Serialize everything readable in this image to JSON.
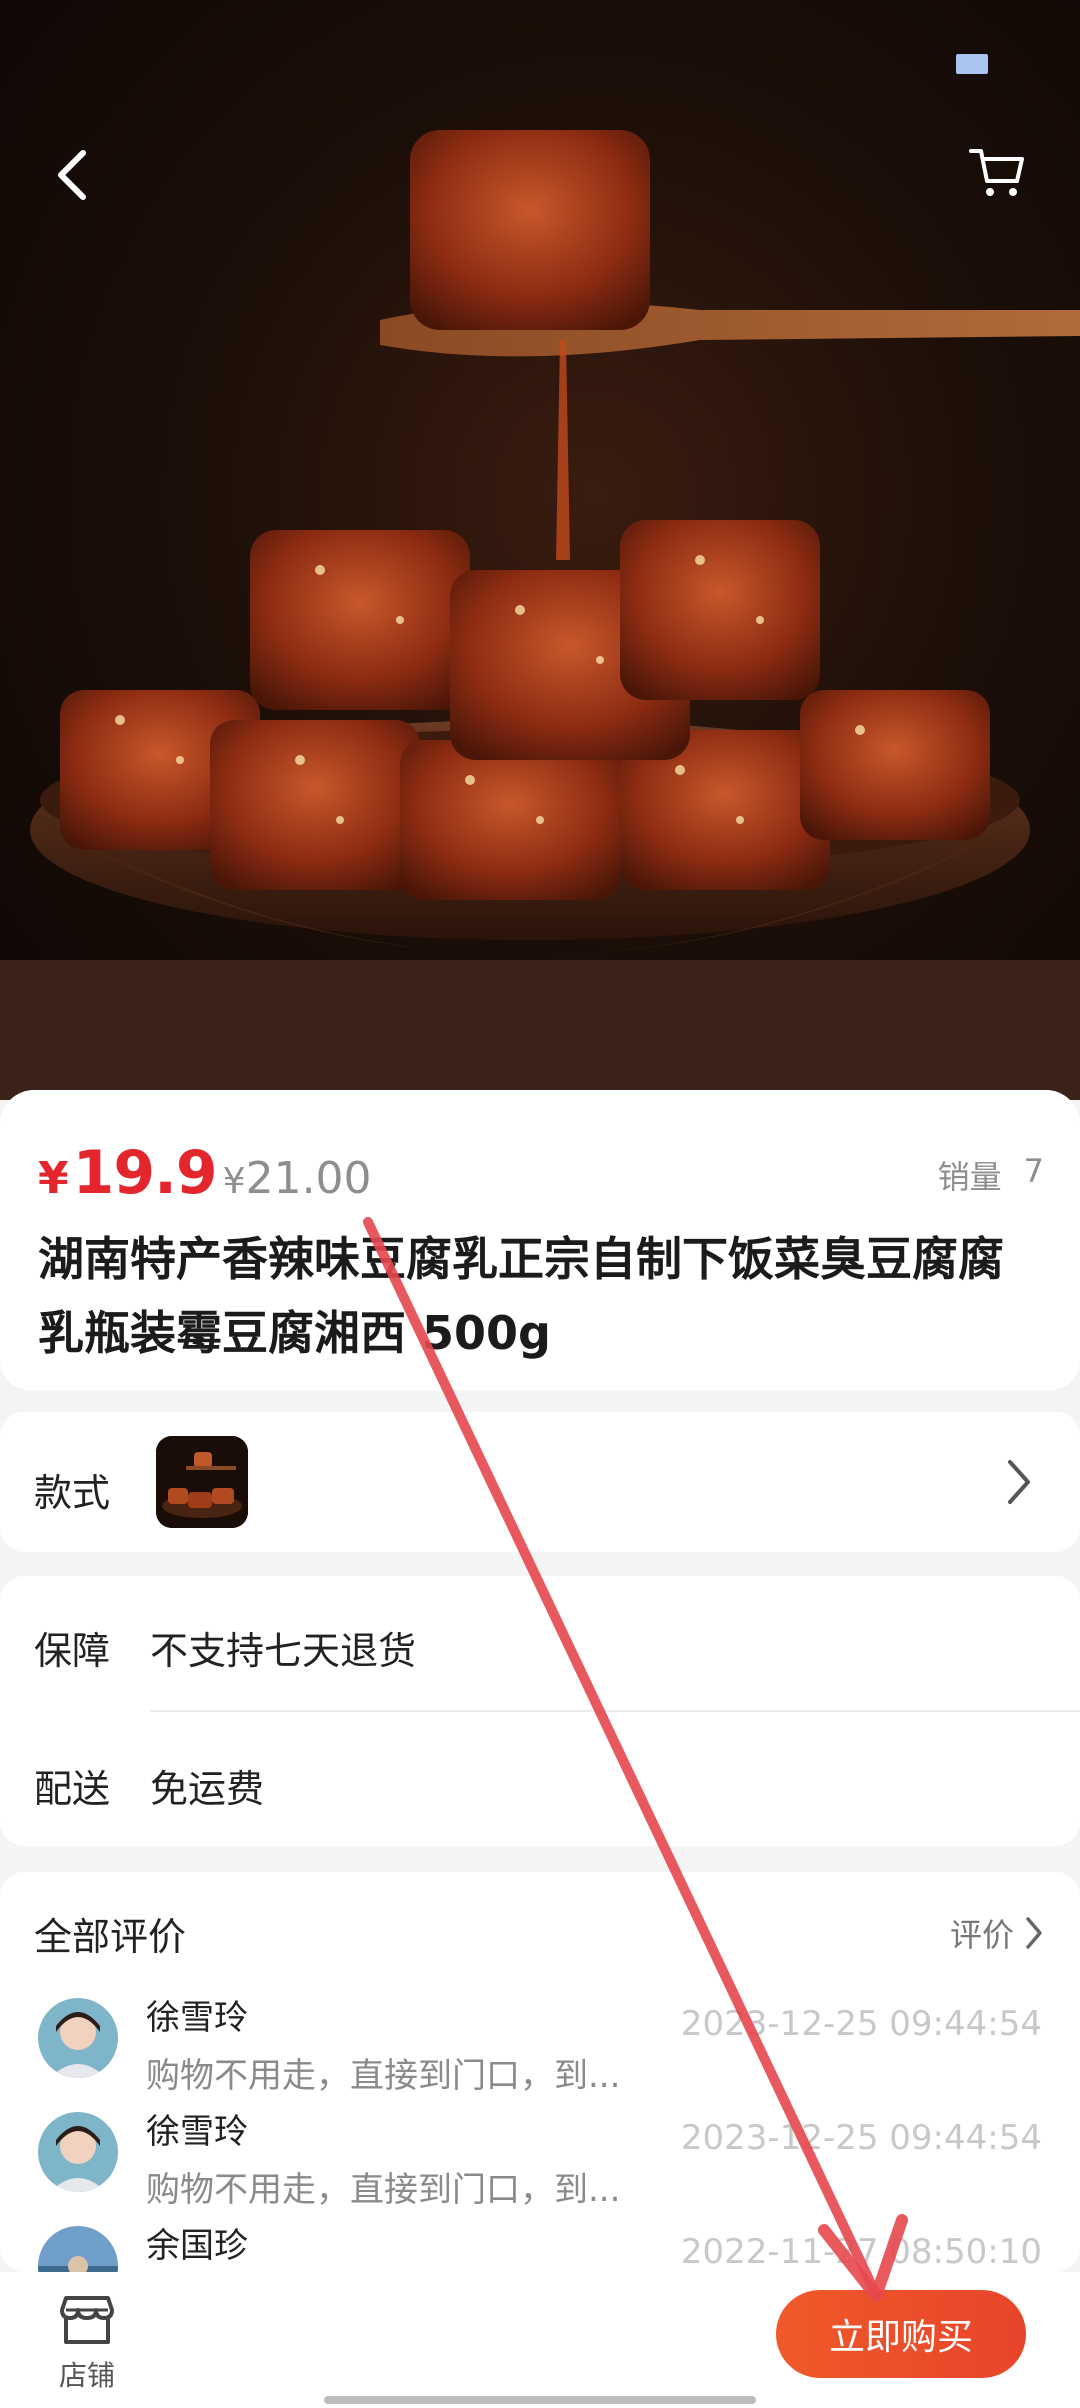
{
  "product": {
    "currency_symbol": "¥",
    "price": "19.9",
    "original_currency_symbol": "¥",
    "original_price": "21.00",
    "sales_label": "销量",
    "sales_count": "7",
    "title": "湖南特产香辣味豆腐乳正宗自制下饭菜臭豆腐腐乳瓶装霉豆腐湘西 500g"
  },
  "style_row": {
    "label": "款式"
  },
  "guarantee": {
    "label": "保障",
    "value": "不支持七天退货"
  },
  "delivery": {
    "label": "配送",
    "value": "免运费"
  },
  "reviews": {
    "header": "全部评价",
    "more_label": "评价",
    "items": [
      {
        "name": "徐雪玲",
        "text": "购物不用走，直接到门口，到...",
        "time": "2023-12-25  09:44:54"
      },
      {
        "name": "徐雪玲",
        "text": "购物不用走，直接到门口，到...",
        "time": "2023-12-25  09:44:54"
      },
      {
        "name": "余国珍",
        "text": "",
        "time": "2022-11-27  08:50:10"
      }
    ]
  },
  "bottom_bar": {
    "shop_label": "店铺",
    "buy_label": "立即购买"
  },
  "colors": {
    "accent": "#e3262c",
    "buy_button": "#ea4c2a",
    "arrow": "#e5484d"
  },
  "icons": [
    "back-icon",
    "cart-icon",
    "chevron-right-icon",
    "store-icon"
  ]
}
